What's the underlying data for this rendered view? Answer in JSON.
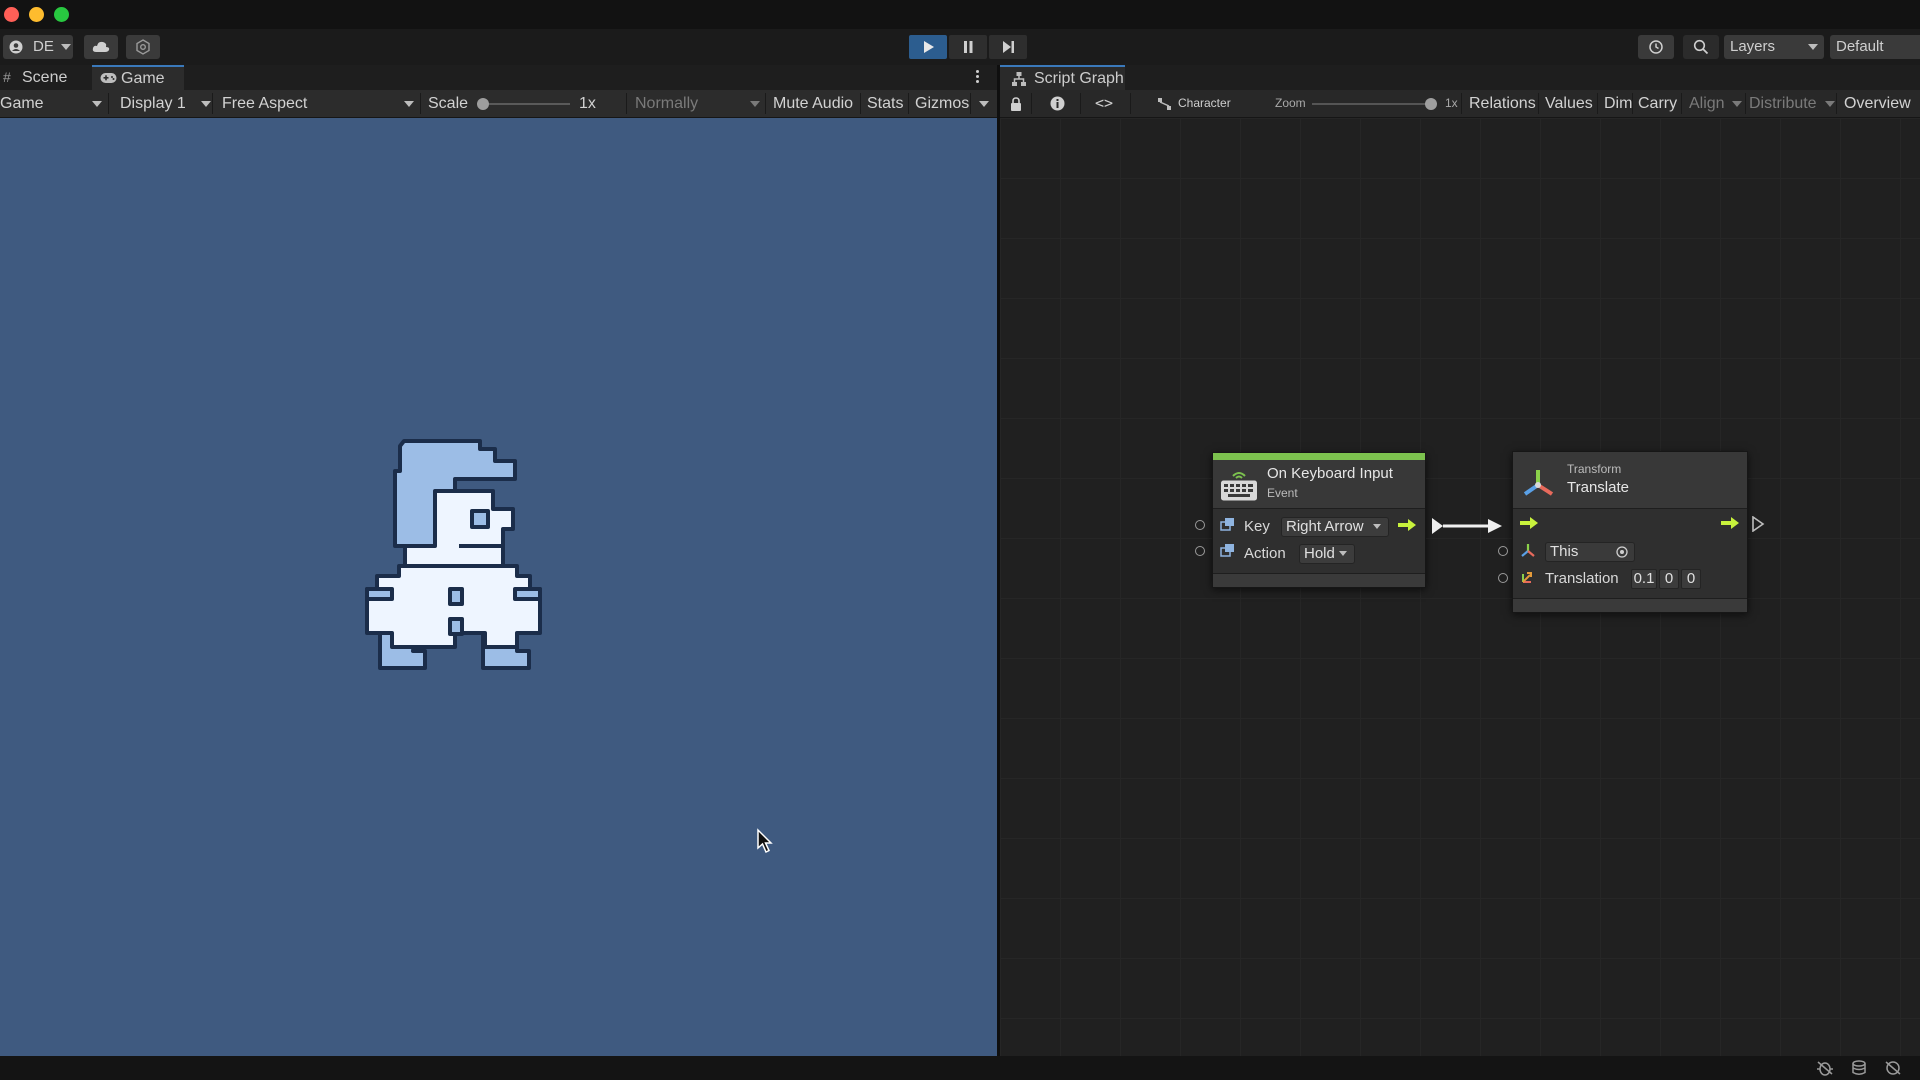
{
  "toolbar": {
    "account_label": "DE",
    "layers_label": "Layers",
    "layout_label": "Default"
  },
  "game_panel": {
    "tabs": [
      "Scene",
      "Game"
    ],
    "view_mode": "Game",
    "display": "Display 1",
    "aspect": "Free Aspect",
    "scale_label": "Scale",
    "scale_value": "1x",
    "play_focus": "Normally",
    "mute_audio": "Mute Audio",
    "stats": "Stats",
    "gizmos": "Gizmos",
    "background_color": "#3f5a80"
  },
  "script_graph": {
    "tab_title": "Script Graph",
    "breadcrumb": "Character",
    "zoom_label": "Zoom",
    "zoom_value": "1x",
    "toolbar_buttons": [
      "Relations",
      "Values",
      "Dim",
      "Carry",
      "Align",
      "Distribute",
      "Overview"
    ]
  },
  "nodes": {
    "keyboard": {
      "title": "On Keyboard Input",
      "subtitle": "Event",
      "key_label": "Key",
      "key_value": "Right Arrow",
      "action_label": "Action",
      "action_value": "Hold",
      "accent_color": "#7cc24e"
    },
    "translate": {
      "category": "Transform",
      "title": "Translate",
      "target_label": "This",
      "translation_label": "Translation",
      "translation_x": "0.1",
      "translation_y": "0",
      "translation_z": "0"
    }
  },
  "colors": {
    "play_active": "#2c5d8f",
    "flow_arrow": "#c8f23c"
  }
}
